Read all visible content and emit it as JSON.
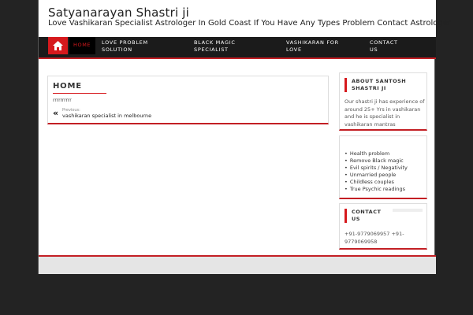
{
  "header": {
    "site_title": "Satyanarayan Shastri ji",
    "site_description": "Love Vashikaran Specialist Astrologer In Gold Coast If You Have Any Types Problem Contact Astrologer"
  },
  "nav": {
    "home_icon": "home-icon",
    "items": [
      {
        "label": "HOME"
      },
      {
        "label": "LOVE PROBLEM SOLUTION"
      },
      {
        "label": "BLACK MAGIC SPECIALIST"
      },
      {
        "label": "VASHIKARAN FOR LOVE"
      },
      {
        "label": "CONTACT US"
      }
    ]
  },
  "main": {
    "title": "HOME",
    "content": "rrrrrrrrrr",
    "prev_label": "Previous:",
    "prev_link": "vashikaran specialist in melbourne"
  },
  "sidebar": {
    "about": {
      "title": "ABOUT SANTOSH SHASTRI JI",
      "text": "Our shastri ji has experience of around 25+ Yrs in vashikaran and he is specialist in vashikaran mantras"
    },
    "services": [
      "Health problem",
      "Remove Black magic",
      "Evil spirits / Negativity",
      "Unmarried people",
      "Childless couples",
      "True Psychic readings"
    ],
    "contact": {
      "title": "CONTACT US",
      "text": "+91-9779069957 +91-9779069958"
    }
  },
  "colors": {
    "accent": "#d6191d",
    "nav_bg": "#1b1b1b",
    "page_bg": "#232323"
  }
}
